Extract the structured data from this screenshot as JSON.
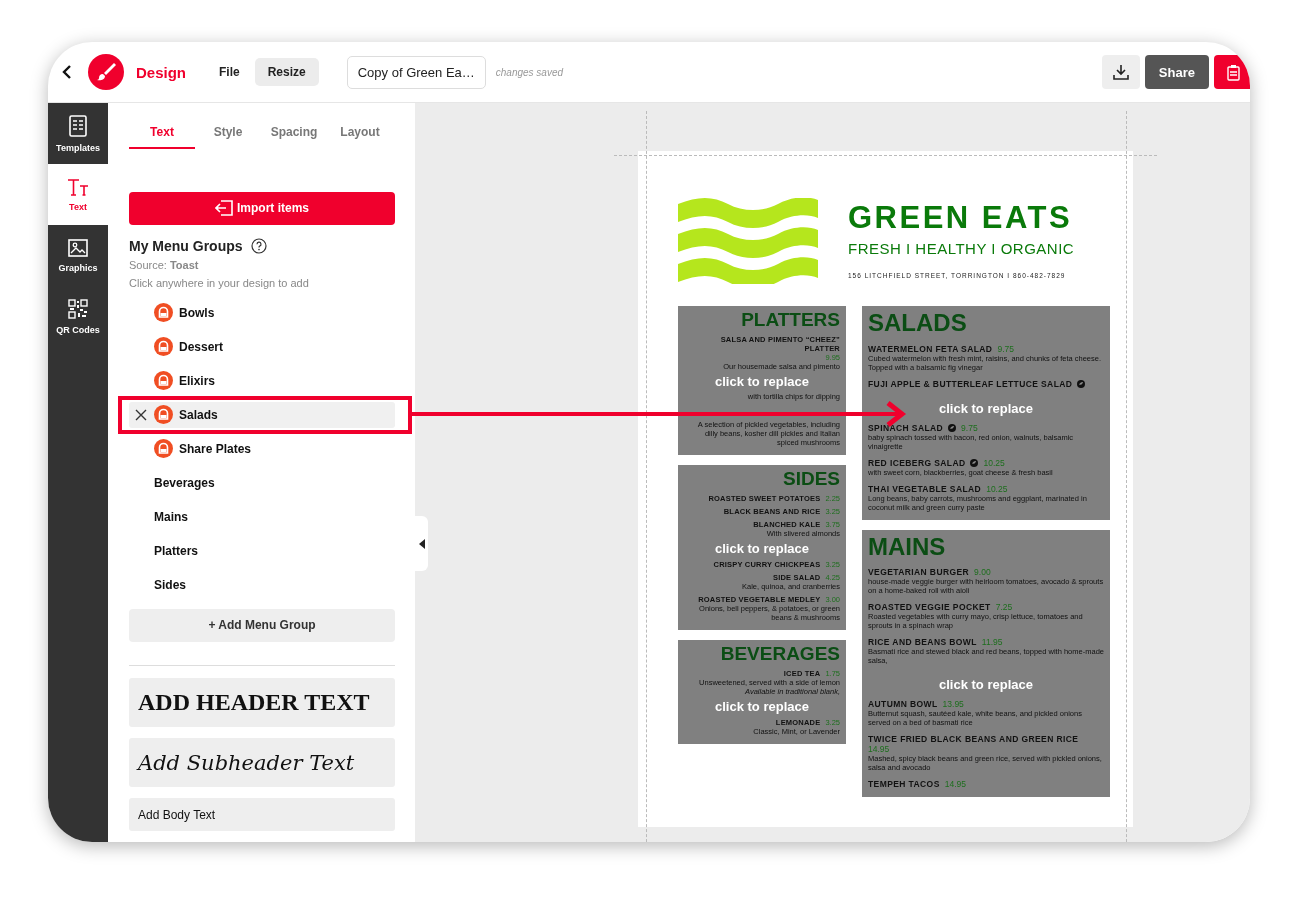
{
  "topbar": {
    "app_name": "Design",
    "menus": [
      {
        "label": "File",
        "selected": false
      },
      {
        "label": "Resize",
        "selected": true
      }
    ],
    "document_title": "Copy of Green Ea…",
    "save_status": "changes saved",
    "share_label": "Share"
  },
  "rail": [
    {
      "kind": "templates",
      "label": "Templates",
      "selected": false
    },
    {
      "kind": "text",
      "label": "Text",
      "selected": true
    },
    {
      "kind": "graphics",
      "label": "Graphics",
      "selected": false
    },
    {
      "kind": "qr",
      "label": "QR Codes",
      "selected": false
    }
  ],
  "panel": {
    "tabs": [
      {
        "label": "Text",
        "selected": true
      },
      {
        "label": "Style",
        "selected": false
      },
      {
        "label": "Spacing",
        "selected": false
      },
      {
        "label": "Layout",
        "selected": false
      }
    ],
    "import_button": "Import items",
    "groups_title": "My Menu Groups",
    "source": "Source: **Toast**",
    "hint": "Click anywhere in your design to add",
    "groups": [
      {
        "label": "Bowls",
        "linked": true,
        "selected": false
      },
      {
        "label": "Dessert",
        "linked": true,
        "selected": false
      },
      {
        "label": "Elixirs",
        "linked": true,
        "selected": false
      },
      {
        "label": "Salads",
        "linked": true,
        "selected": true
      },
      {
        "label": "Share Plates",
        "linked": true,
        "selected": false
      },
      {
        "label": "Beverages",
        "linked": false,
        "selected": false
      },
      {
        "label": "Mains",
        "linked": false,
        "selected": false
      },
      {
        "label": "Platters",
        "linked": false,
        "selected": false
      },
      {
        "label": "Sides",
        "linked": false,
        "selected": false
      }
    ],
    "add_group_button": "+ Add Menu Group",
    "text_presets": [
      {
        "kind": "header",
        "label": "ADD HEADER TEXT"
      },
      {
        "kind": "subheader",
        "label": "Add Subheader Text"
      },
      {
        "kind": "body",
        "label": "Add Body Text"
      }
    ]
  },
  "menu": {
    "title": "GREEN EATS",
    "tagline": "FRESH I HEALTHY I ORGANIC",
    "address": "156 LITCHFIELD STREET, TORRINGTON I 860-482-7829",
    "columns": [
      [
        {
          "title": "PLATTERS",
          "lines": [
            {
              "kind": "heading",
              "name": "SALSA AND PIMENTO “CHEEZ” PLATTER",
              "price": "9.95"
            },
            {
              "kind": "text",
              "text": "Our housemade salsa and pimento"
            },
            {
              "kind": "overlay",
              "text": "click to replace"
            },
            {
              "kind": "text",
              "text": "with tortilla chips for dipping"
            },
            {
              "kind": "text",
              "text": "A selection of pickled vegetables, including dilly beans, kosher dill pickles and Italian spiced mushrooms"
            }
          ]
        },
        {
          "title": "SIDES",
          "lines": [
            {
              "kind": "heading",
              "name": "ROASTED SWEET POTATOES",
              "price": "2.25"
            },
            {
              "kind": "heading",
              "name": "BLACK BEANS AND RICE",
              "price": "3.25"
            },
            {
              "kind": "heading",
              "name": "BLANCHED KALE",
              "price": "3.75"
            },
            {
              "kind": "text",
              "text": "With slivered almonds"
            },
            {
              "kind": "overlay",
              "text": "click to replace"
            },
            {
              "kind": "heading",
              "name": "CRISPY CURRY CHICKPEAS",
              "price": "3.25"
            },
            {
              "kind": "heading",
              "name": "SIDE SALAD",
              "price": "4.25"
            },
            {
              "kind": "text",
              "text": "Kale, quinoa, and cranberries"
            },
            {
              "kind": "heading",
              "name": "ROASTED VEGETABLE MEDLEY",
              "price": "3.00"
            },
            {
              "kind": "text",
              "text": "Onions, bell peppers, & potatoes, or green beans & mushrooms"
            }
          ]
        },
        {
          "title": "BEVERAGES",
          "lines": [
            {
              "kind": "heading",
              "name": "ICED TEA",
              "price": "1.75"
            },
            {
              "kind": "text",
              "text": "Unsweetened, served with a side of lemon"
            },
            {
              "kind": "note",
              "text": "Available in traditional blank,"
            },
            {
              "kind": "overlay",
              "text": "click to replace"
            },
            {
              "kind": "heading",
              "name": "LEMONADE",
              "price": "3.25"
            },
            {
              "kind": "text",
              "text": "Classic, Mint, or Lavender"
            }
          ]
        }
      ],
      [
        {
          "title": "SALADS",
          "lines": [
            {
              "kind": "heading",
              "name": "WATERMELON FETA SALAD",
              "price": "9.75"
            },
            {
              "kind": "text",
              "text": "Cubed watermelon with fresh mint, raisins, and chunks of feta cheese. Topped with a balsamic fig vinegar"
            },
            {
              "kind": "heading",
              "name": "FUJI APPLE & BUTTERLEAF LETTUCE SALAD",
              "tagged": true
            },
            {
              "kind": "overlay",
              "text": "click to replace"
            },
            {
              "kind": "heading",
              "name": "SPINACH SALAD",
              "price": "9.75",
              "tagged": true
            },
            {
              "kind": "text",
              "text": "baby spinach tossed with bacon, red onion, walnuts, balsamic vinaigrette"
            },
            {
              "kind": "heading",
              "name": "RED ICEBERG SALAD",
              "price": "10.25",
              "tagged": true
            },
            {
              "kind": "text",
              "text": "with sweet corn, blackberries, goat cheese & fresh basil"
            },
            {
              "kind": "heading",
              "name": "THAI VEGETABLE SALAD",
              "price": "10.25"
            },
            {
              "kind": "text",
              "text": "Long beans, baby carrots, mushrooms and eggplant, marinated in coconut milk and green curry paste"
            }
          ]
        },
        {
          "title": "MAINS",
          "lines": [
            {
              "kind": "heading",
              "name": "VEGETARIAN BURGER",
              "price": "9.00"
            },
            {
              "kind": "text",
              "text": "house-made veggie burger with heirloom tomatoes, avocado & sprouts on a home-baked roll with aioli"
            },
            {
              "kind": "heading",
              "name": "ROASTED VEGGIE POCKET",
              "price": "7.25"
            },
            {
              "kind": "text",
              "text": "Roasted vegetables with curry mayo, crisp lettuce, tomatoes and sprouts in a spinach wrap"
            },
            {
              "kind": "heading",
              "name": "RICE AND BEANS BOWL",
              "price": "11.95"
            },
            {
              "kind": "text",
              "text": "Basmati rice and stewed black and red beans, topped with home-made salsa,"
            },
            {
              "kind": "overlay",
              "text": "click to replace"
            },
            {
              "kind": "heading",
              "name": "AUTUMN BOWL",
              "price": "13.95"
            },
            {
              "kind": "text",
              "text": "Butternut squash, sautéed kale, white beans, and pickled onions served on a bed of basmati rice"
            },
            {
              "kind": "heading",
              "name": "TWICE FRIED BLACK BEANS AND GREEN RICE",
              "price": "14.95"
            },
            {
              "kind": "text",
              "text": "Mashed, spicy black beans and green rice, served with pickled onions, salsa and avocado"
            },
            {
              "kind": "heading",
              "name": "TEMPEH TACOS",
              "price": "14.95"
            }
          ]
        }
      ]
    ]
  }
}
